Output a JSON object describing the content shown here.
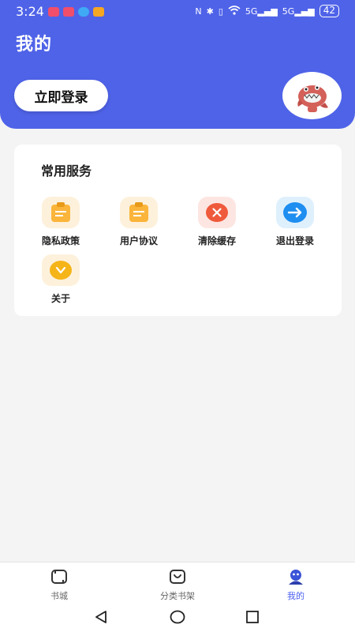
{
  "status_bar": {
    "time": "3:24",
    "signal_1": "5G",
    "signal_2": "5G",
    "battery": "42"
  },
  "header": {
    "title": "我的",
    "login_label": "立即登录",
    "accent_color": "#4f63e8"
  },
  "services": {
    "title": "常用服务",
    "items": [
      {
        "label": "隐私政策",
        "icon": "clipboard-icon",
        "color": "#fbb53b"
      },
      {
        "label": "用户协议",
        "icon": "clipboard-icon",
        "color": "#fbb53b"
      },
      {
        "label": "清除缓存",
        "icon": "close-circle-icon",
        "color": "#ef5a3c"
      },
      {
        "label": "退出登录",
        "icon": "arrow-right-circle-icon",
        "color": "#1e8ef0"
      },
      {
        "label": "关于",
        "icon": "chevron-down-circle-icon",
        "color": "#f5b418"
      }
    ]
  },
  "bottom_nav": {
    "items": [
      {
        "label": "书城",
        "icon": "book-store-icon"
      },
      {
        "label": "分类书架",
        "icon": "bookshelf-icon"
      },
      {
        "label": "我的",
        "icon": "profile-icon",
        "active": true
      }
    ]
  }
}
